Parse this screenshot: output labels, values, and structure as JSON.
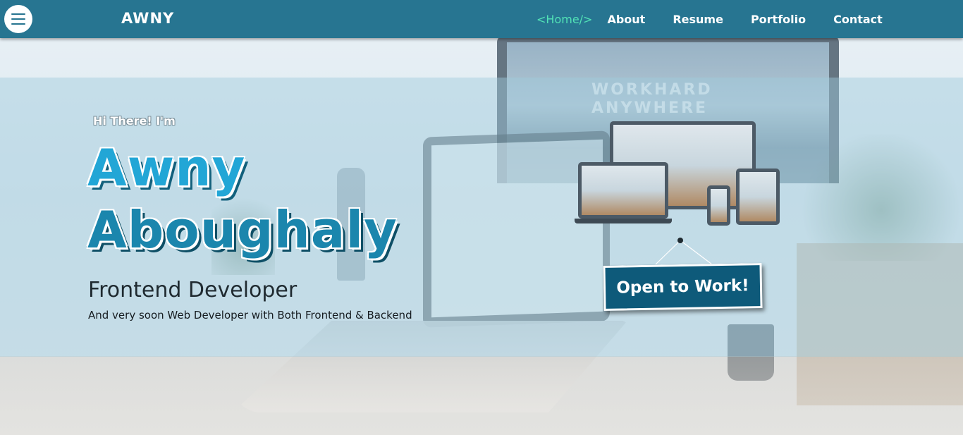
{
  "header": {
    "logo": "AWNY",
    "nav": [
      {
        "label": "<Home/>",
        "active": true
      },
      {
        "label": "About",
        "active": false
      },
      {
        "label": "Resume",
        "active": false
      },
      {
        "label": "Portfolio",
        "active": false
      },
      {
        "label": "Contact",
        "active": false
      }
    ]
  },
  "hero": {
    "greeting": "Hi There! I'm",
    "first_name": "Awny",
    "last_name": "Aboughaly",
    "role": "Frontend Developer",
    "subtitle": "And very soon Web Developer with Both Frontend & Backend",
    "badge_label": "Open to Work!"
  },
  "background": {
    "monitor_text": "WORKHARD ANYWHERE"
  },
  "colors": {
    "header_bg": "#277591",
    "nav_active": "#52e3b6",
    "name_primary": "#22a6d6",
    "badge_bg": "#0e5a7a"
  },
  "icons": {
    "menu": "hamburger-menu-icon",
    "devices": "responsive-devices-illustration"
  }
}
